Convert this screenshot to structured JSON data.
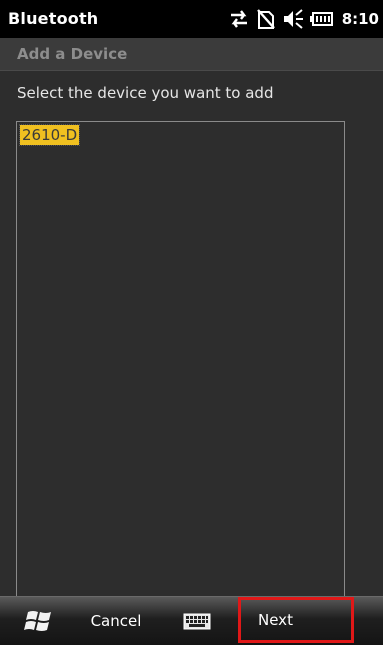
{
  "statusbar": {
    "app_title": "Bluetooth",
    "time": "8:10",
    "icons": [
      "data-sync-icon",
      "no-sim-icon",
      "speaker-icon",
      "battery-icon"
    ]
  },
  "page": {
    "title": "Add a Device",
    "instruction": "Select the device you want to add"
  },
  "device_list": {
    "items": [
      {
        "label": "2610-D",
        "selected": true
      }
    ]
  },
  "cmdbar": {
    "cancel_label": "Cancel",
    "next_label": "Next",
    "icons": [
      "windows-start-icon",
      "keyboard-icon"
    ]
  },
  "colors": {
    "background": "#2d2d2d",
    "selection": "#f0c020",
    "highlight_border": "#e01818"
  }
}
